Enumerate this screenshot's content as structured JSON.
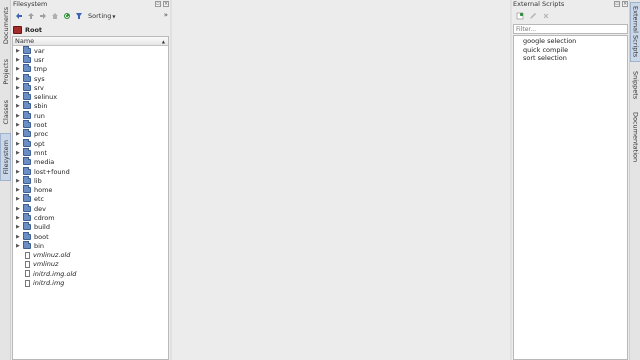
{
  "left_tabs": [
    {
      "label": "Documents",
      "icon": "document-icon",
      "active": false
    },
    {
      "label": "Projects",
      "icon": "project-icon",
      "active": false
    },
    {
      "label": "Classes",
      "icon": "classes-icon",
      "active": false
    },
    {
      "label": "Filesystem",
      "icon": "filesystem-icon",
      "active": true
    }
  ],
  "right_tabs": [
    {
      "label": "External Scripts",
      "icon": "scripts-icon",
      "active": true
    },
    {
      "label": "Snippets",
      "icon": "snippets-icon",
      "active": false
    },
    {
      "label": "Documentation",
      "icon": "documentation-icon",
      "active": false
    }
  ],
  "filesystem": {
    "title": "Filesystem",
    "toolbar": {
      "sorting_label": "Sorting",
      "more_label": "»"
    },
    "root_label": "Root",
    "column_header": "Name",
    "items": [
      {
        "name": "var",
        "type": "folder"
      },
      {
        "name": "usr",
        "type": "folder"
      },
      {
        "name": "tmp",
        "type": "folder"
      },
      {
        "name": "sys",
        "type": "folder"
      },
      {
        "name": "srv",
        "type": "folder"
      },
      {
        "name": "selinux",
        "type": "folder"
      },
      {
        "name": "sbin",
        "type": "folder"
      },
      {
        "name": "run",
        "type": "folder"
      },
      {
        "name": "root",
        "type": "folder"
      },
      {
        "name": "proc",
        "type": "folder"
      },
      {
        "name": "opt",
        "type": "folder"
      },
      {
        "name": "mnt",
        "type": "folder"
      },
      {
        "name": "media",
        "type": "folder"
      },
      {
        "name": "lost+found",
        "type": "folder"
      },
      {
        "name": "lib",
        "type": "folder"
      },
      {
        "name": "home",
        "type": "folder"
      },
      {
        "name": "etc",
        "type": "folder"
      },
      {
        "name": "dev",
        "type": "folder"
      },
      {
        "name": "cdrom",
        "type": "folder"
      },
      {
        "name": "build",
        "type": "folder"
      },
      {
        "name": "boot",
        "type": "folder"
      },
      {
        "name": "bin",
        "type": "folder"
      },
      {
        "name": "vmlinuz.old",
        "type": "file"
      },
      {
        "name": "vmlinuz",
        "type": "file"
      },
      {
        "name": "initrd.img.old",
        "type": "file"
      },
      {
        "name": "initrd.img",
        "type": "file"
      }
    ]
  },
  "external_scripts": {
    "title": "External Scripts",
    "filter_placeholder": "Filter...",
    "items": [
      "google selection",
      "quick compile",
      "sort selection"
    ]
  },
  "colors": {
    "folder": "#6b8fc4",
    "root_icon": "#a52a2a",
    "active_tab": "#c9d7e8"
  }
}
